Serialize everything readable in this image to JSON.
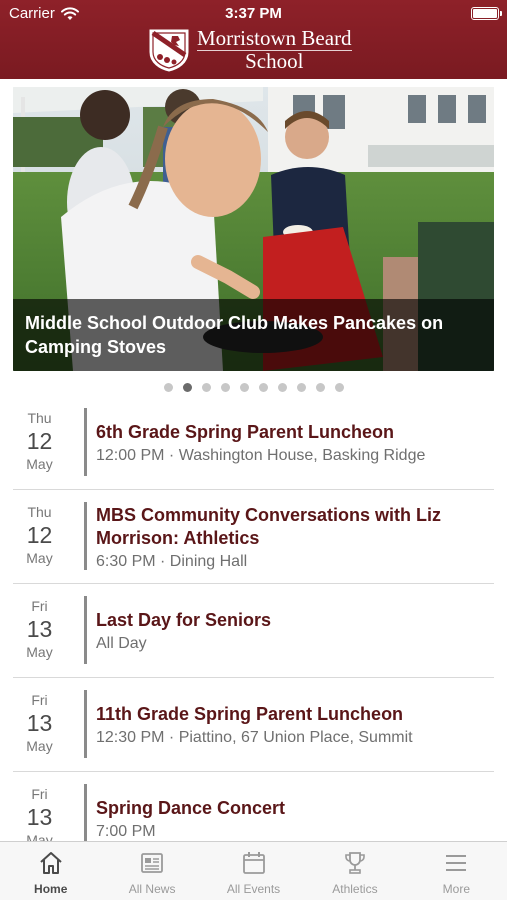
{
  "status_bar": {
    "carrier": "Carrier",
    "time": "3:37 PM"
  },
  "brand": {
    "name_line1": "Morristown Beard",
    "name_line2": "School"
  },
  "colors": {
    "brand": "#8e2129",
    "title_text": "#5a1618"
  },
  "carousel": {
    "caption": "Middle School Outdoor Club Makes Pancakes on Camping Stoves",
    "slide_count": 10,
    "active_index": 1
  },
  "events": [
    {
      "dow": "Thu",
      "day": "12",
      "month": "May",
      "title": "6th Grade Spring Parent Luncheon",
      "subtitle": "12:00 PM · Washington House, Basking Ridge"
    },
    {
      "dow": "Thu",
      "day": "12",
      "month": "May",
      "title": "MBS Community Conversations with Liz Morrison: Athletics",
      "subtitle": "6:30 PM · Dining Hall"
    },
    {
      "dow": "Fri",
      "day": "13",
      "month": "May",
      "title": "Last Day for Seniors",
      "subtitle": "All Day"
    },
    {
      "dow": "Fri",
      "day": "13",
      "month": "May",
      "title": "11th Grade Spring Parent Luncheon",
      "subtitle": "12:30 PM · Piattino, 67 Union Place, Summit"
    },
    {
      "dow": "Fri",
      "day": "13",
      "month": "May",
      "title": "Spring Dance Concert",
      "subtitle": "7:00 PM"
    }
  ],
  "tabs": [
    {
      "label": "Home",
      "icon": "home-icon",
      "active": true
    },
    {
      "label": "All News",
      "icon": "news-icon",
      "active": false
    },
    {
      "label": "All Events",
      "icon": "calendar-icon",
      "active": false
    },
    {
      "label": "Athletics",
      "icon": "trophy-icon",
      "active": false
    },
    {
      "label": "More",
      "icon": "menu-icon",
      "active": false
    }
  ]
}
